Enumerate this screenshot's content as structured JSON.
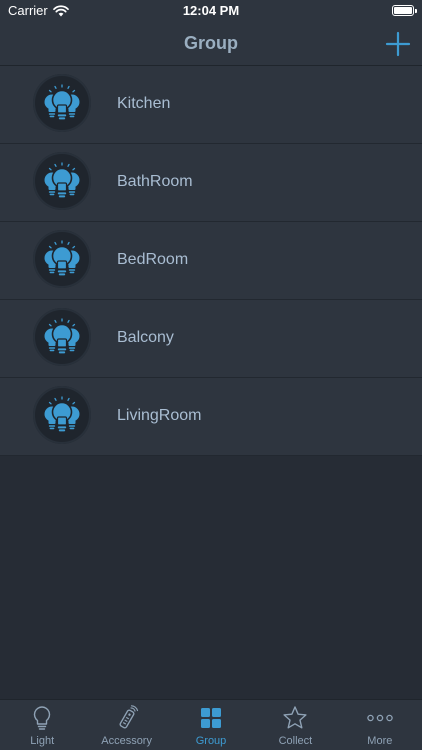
{
  "status_bar": {
    "carrier": "Carrier",
    "time": "12:04 PM",
    "battery_level": 1.0
  },
  "nav": {
    "title": "Group",
    "add_icon": "plus-icon"
  },
  "groups": [
    {
      "name": "Kitchen",
      "icon": "light-bulbs-icon"
    },
    {
      "name": "BathRoom",
      "icon": "light-bulbs-icon"
    },
    {
      "name": "BedRoom",
      "icon": "light-bulbs-icon"
    },
    {
      "name": "Balcony",
      "icon": "light-bulbs-icon"
    },
    {
      "name": "LivingRoom",
      "icon": "light-bulbs-icon"
    }
  ],
  "tabs": [
    {
      "label": "Light",
      "icon": "bulb-icon",
      "active": false
    },
    {
      "label": "Accessory",
      "icon": "remote-icon",
      "active": false
    },
    {
      "label": "Group",
      "icon": "grid-icon",
      "active": true
    },
    {
      "label": "Collect",
      "icon": "star-icon",
      "active": false
    },
    {
      "label": "More",
      "icon": "more-dots-icon",
      "active": false
    }
  ],
  "colors": {
    "background": "#262c35",
    "bar": "#2e353f",
    "accent": "#3d9bd2",
    "title": "#9aaec0",
    "item_text": "#a9bdd2",
    "tab_inactive": "#8fa2b5"
  }
}
